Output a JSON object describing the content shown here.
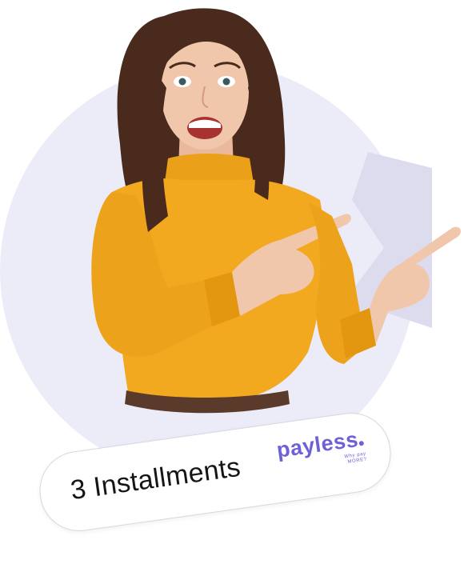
{
  "badge": {
    "label": "3 Installments",
    "brand_name": "payless",
    "brand_tagline": "Why pay\nMORE?"
  },
  "colors": {
    "background_circle": "#ececf8",
    "brand_purple": "#6d60d8",
    "sweater": "#f2a81f",
    "hair": "#4a2a1c",
    "skin": "#f1c7ac"
  },
  "icons": {
    "background_shape": "abstract-chevron-shape",
    "person": "woman-pointing-illustration"
  }
}
